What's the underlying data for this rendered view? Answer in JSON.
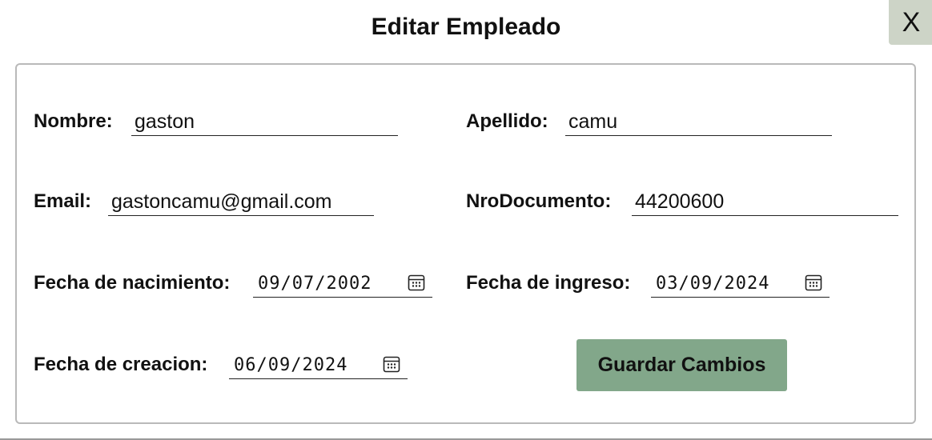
{
  "dialog": {
    "title": "Editar Empleado",
    "close_label": "X"
  },
  "form": {
    "nombre": {
      "label": "Nombre:",
      "value": "gaston"
    },
    "apellido": {
      "label": "Apellido:",
      "value": "camu"
    },
    "email": {
      "label": "Email:",
      "value": "gastoncamu@gmail.com"
    },
    "nro_documento": {
      "label": "NroDocumento:",
      "value": "44200600"
    },
    "fecha_nacimiento": {
      "label": "Fecha de nacimiento:",
      "value": "09/07/2002"
    },
    "fecha_ingreso": {
      "label": "Fecha de ingreso:",
      "value": "03/09/2024"
    },
    "fecha_creacion": {
      "label": "Fecha de creacion:",
      "value": "06/09/2024"
    },
    "submit_label": "Guardar Cambios"
  },
  "colors": {
    "close_button_bg": "#cdd4c7",
    "save_button_bg": "#82a78a",
    "card_border": "#b9b9b9"
  },
  "icons": {
    "calendar": "calendar-icon",
    "close": "close-icon"
  }
}
